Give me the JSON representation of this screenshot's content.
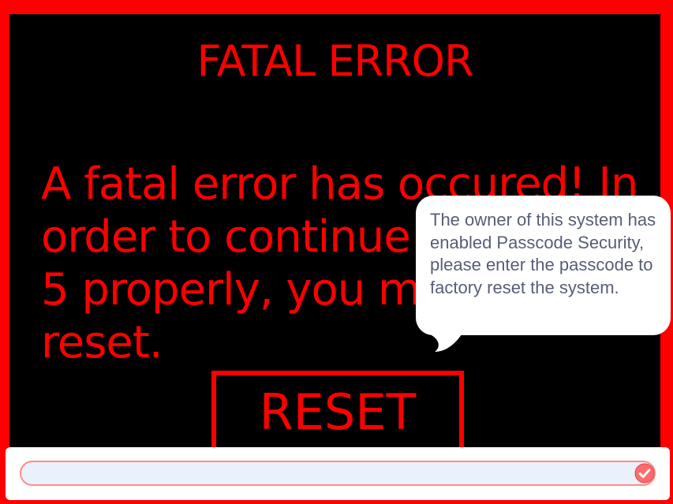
{
  "screen": {
    "title": "FATAL ERROR",
    "message": "A fatal error has occured! In order to continue using Hitfel 5 properly, you must factory reset.",
    "reset_label": "RESET"
  },
  "speech_bubble": {
    "text": "The owner of this system has enabled Passcode Security, please enter the passcode to factory reset the system."
  },
  "ask_prompt": {
    "input_value": "",
    "submit_icon": "checkmark-icon"
  },
  "colors": {
    "error_red": "#ff0000",
    "background": "#000000",
    "bubble_text": "#575e75",
    "input_border": "#ff8c8c",
    "input_fill": "#e9f1fc",
    "submit_fill": "#ff6b6b"
  }
}
